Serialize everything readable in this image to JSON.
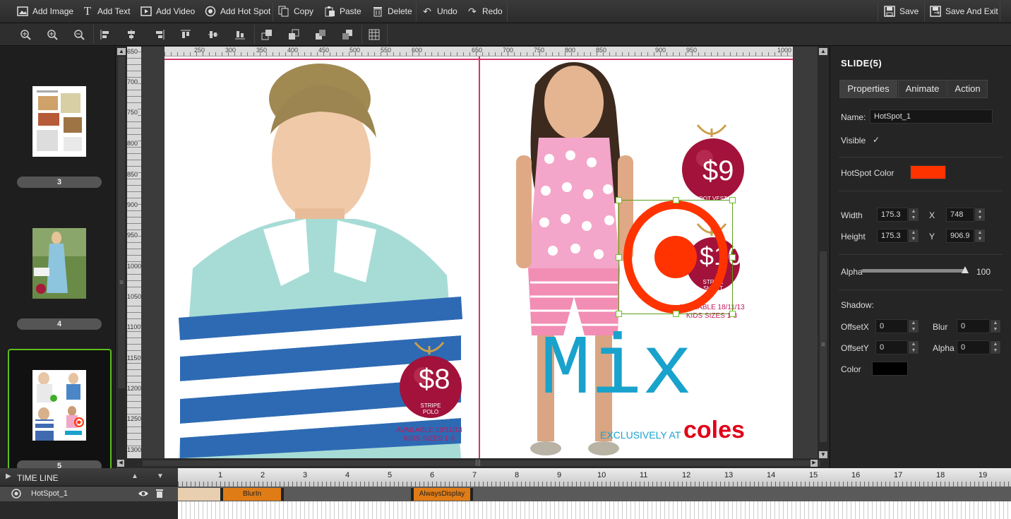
{
  "toolbar": {
    "add_image": "Add Image",
    "add_text": "Add Text",
    "add_video": "Add Video",
    "add_hotspot": "Add Hot Spot",
    "copy": "Copy",
    "paste": "Paste",
    "delete": "Delete",
    "undo": "Undo",
    "redo": "Redo",
    "save": "Save",
    "save_exit": "Save And Exit"
  },
  "slides": [
    {
      "number": "3"
    },
    {
      "number": "4"
    },
    {
      "number": "5"
    }
  ],
  "ruler": {
    "horizontal": [
      "250",
      "300",
      "350",
      "400",
      "450",
      "500",
      "550",
      "600",
      "650",
      "700",
      "750",
      "800",
      "850",
      "900",
      "950",
      "1000"
    ],
    "vertical": [
      "650",
      "700",
      "750",
      "800",
      "850",
      "900",
      "950",
      "1000",
      "1050",
      "1100",
      "1150",
      "1200",
      "1250",
      "1300"
    ]
  },
  "canvas": {
    "price_8": "$8",
    "price_9": "$9",
    "price_10": "$10",
    "tag_8": "STRIPE POLO",
    "tag_9": "DOT VEST",
    "tag_10": "STRIPE SHORT",
    "avail_1": "AVAILABLE 18/11/13",
    "avail_2": "KIDS SIZES 1-8",
    "avail_3": "AVAILABLE 18/11/13",
    "avail_4": "KIDS SIZES 1-8",
    "mix": "Mix",
    "exclusively": "EXCLUSIVELY AT",
    "coles": "coles"
  },
  "panel": {
    "title": "SLIDE(5)",
    "tabs": [
      "Properties",
      "Animate",
      "Action"
    ],
    "name_label": "Name:",
    "name_value": "HotSpot_1",
    "visible_label": "Visible",
    "visible_check": "✓",
    "hotspot_color_label": "HotSpot Color",
    "hotspot_color": "#ff3300",
    "width_label": "Width",
    "width_value": "175.3",
    "x_label": "X",
    "x_value": "748",
    "height_label": "Height",
    "height_value": "175.3",
    "y_label": "Y",
    "y_value": "906.9",
    "alpha_label": "Alpha",
    "alpha_value": "100",
    "shadow_label": "Shadow:",
    "offsetx_label": "OffsetX",
    "offsetx_value": "0",
    "blur_label": "Blur",
    "blur_value": "0",
    "offsety_label": "OffsetY",
    "offsety_value": "0",
    "shadow_alpha_label": "Alpha",
    "shadow_alpha_value": "0",
    "color_label": "Color",
    "shadow_color": "#000000"
  },
  "timeline": {
    "label": "TIME LINE",
    "layer_name": "HotSpot_1",
    "ticks": [
      "1",
      "2",
      "3",
      "4",
      "5",
      "6",
      "7",
      "8",
      "9",
      "10",
      "11",
      "12",
      "13",
      "14",
      "15",
      "16",
      "17",
      "18",
      "19"
    ],
    "clip1": "BlurIn",
    "clip2": "AlwaysDisplay"
  }
}
